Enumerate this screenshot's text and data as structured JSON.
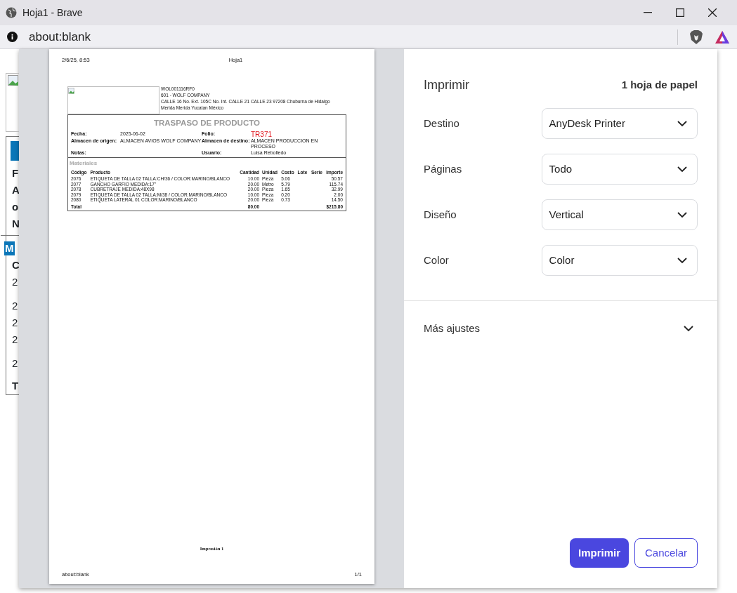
{
  "window": {
    "title": "Hoja1 - Brave"
  },
  "address_bar": {
    "url": "about:blank"
  },
  "background_page": {
    "fragments": [
      {
        "text": "F",
        "highlighted": false
      },
      {
        "text": "A",
        "highlighted": false
      },
      {
        "text": "o",
        "highlighted": false
      },
      {
        "text": "N",
        "highlighted": false
      },
      {
        "text": "M",
        "highlighted": true
      },
      {
        "text": "C",
        "highlighted": false
      },
      {
        "text": "2",
        "highlighted": false
      },
      {
        "text": "2",
        "highlighted": false
      },
      {
        "text": "2",
        "highlighted": false
      },
      {
        "text": "2",
        "highlighted": false
      },
      {
        "text": "2",
        "highlighted": false
      },
      {
        "text": "T",
        "highlighted": false
      }
    ]
  },
  "preview": {
    "header_left": "2/6/25, 8:53",
    "header_center": "Hoja1",
    "company_lines": [
      "WOL001116RF0",
      "601 - WOLF COMPANY",
      "CALLE 16 No. Ext. 105C No. Int. CALLE 21 CALLE 23 97208 Chuburna de Hidalgo Merida Merida Yucatan México"
    ],
    "doc_title": "TRASPASO DE PRODUCTO",
    "fields": [
      {
        "label": "Fecha:",
        "value": "2025-06-02",
        "emphasis": false
      },
      {
        "label": "Folio:",
        "value": "TR371",
        "emphasis": true
      },
      {
        "label": "Almacen de origen:",
        "value": "ALMACEN AVIOS WOLF COMPANY",
        "emphasis": false
      },
      {
        "label": "Almacen de destino:",
        "value": "ALMACEN PRODUCCION EN PROCESO",
        "emphasis": false
      },
      {
        "label": "Notas:",
        "emphasis": false
      },
      {
        "label": "Usuario:",
        "value": "Luisa Rebolledo",
        "emphasis": false
      }
    ],
    "section_title": "Materiales",
    "table": {
      "columns": [
        "Código",
        "Producto",
        "Cantidad",
        "Unidad",
        "Costo",
        "Lote",
        "Serie",
        "Importe"
      ],
      "rows": [
        {
          "code": "2076",
          "product": "ETIQUETA DE TALLA 02",
          "detail": "TALLA:CH/36 / COLOR:MARINO/BLANCO",
          "quantity": "10.00",
          "unit": "Pieza",
          "cost": "5.06",
          "amount": "50.57"
        },
        {
          "code": "2077",
          "product": "GANCHO GARFIO",
          "detail": "MEDIDA:17\"",
          "quantity": "20.00",
          "unit": "Metro",
          "cost": "5.79",
          "amount": "115.74"
        },
        {
          "code": "2078",
          "product": "CUBRETRAJE",
          "detail": "MEDIDA:48X98",
          "quantity": "20.00",
          "unit": "Pieza",
          "cost": "1.65",
          "amount": "32.99"
        },
        {
          "code": "2079",
          "product": "ETIQUETA DE TALLA 02",
          "detail": "TALLA:M/38 / COLOR:MARINO/BLANCO",
          "quantity": "10.00",
          "unit": "Pieza",
          "cost": "0.20",
          "amount": "2.00"
        },
        {
          "code": "2080",
          "product": "ETIQUETA LATERAL 01",
          "detail": "COLOR:MARINO/BLANCO",
          "quantity": "20.00",
          "unit": "Pieza",
          "cost": "0.73",
          "amount": "14.50"
        }
      ],
      "total": {
        "label": "Total",
        "quantity": "80.00",
        "amount": "$215.80"
      }
    },
    "footer_center": "Impresión 1",
    "footer_left": "about:blank",
    "footer_right": "1/1"
  },
  "settings": {
    "title": "Imprimir",
    "sheets": "1 hoja de papel",
    "options": [
      {
        "label": "Destino",
        "value": "AnyDesk Printer"
      },
      {
        "label": "Páginas",
        "value": "Todo"
      },
      {
        "label": "Diseño",
        "value": "Vertical"
      },
      {
        "label": "Color",
        "value": "Color"
      }
    ],
    "more": {
      "label": "Más ajustes",
      "expanded": false
    },
    "buttons": [
      {
        "label": "Imprimir",
        "kind": "primary"
      },
      {
        "label": "Cancelar",
        "kind": "secondary"
      }
    ]
  }
}
